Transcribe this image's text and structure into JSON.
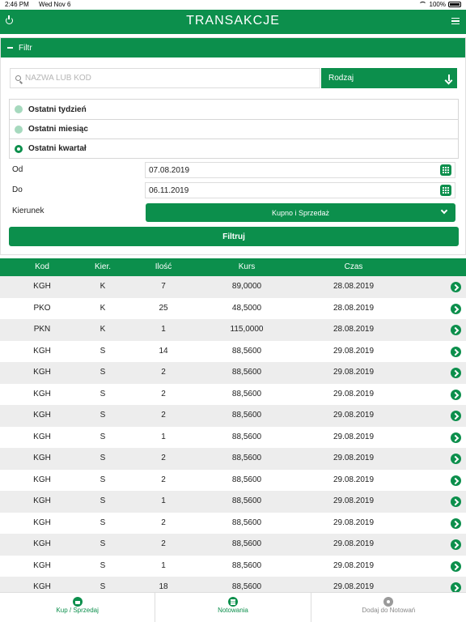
{
  "status_bar": {
    "time": "2:46 PM",
    "date": "Wed Nov 6",
    "battery": "100%"
  },
  "header": {
    "title": "TRANSAKCJE"
  },
  "filter": {
    "toggle_label": "Filtr",
    "search_placeholder": "NAZWA LUB KOD",
    "kind_label": "Rodzaj",
    "periods": [
      {
        "label": "Ostatni tydzień",
        "selected": false
      },
      {
        "label": "Ostatni miesiąc",
        "selected": false
      },
      {
        "label": "Ostatni kwartał",
        "selected": true
      }
    ],
    "from_label": "Od",
    "from_value": "07.08.2019",
    "to_label": "Do",
    "to_value": "06.11.2019",
    "direction_label": "Kierunek",
    "direction_value": "Kupno i Sprzedaż",
    "submit_label": "Filtruj"
  },
  "table": {
    "columns": {
      "kod": "Kod",
      "kier": "Kier.",
      "ilosc": "Ilość",
      "kurs": "Kurs",
      "czas": "Czas"
    },
    "rows": [
      {
        "kod": "KGH",
        "kier": "K",
        "ilosc": "7",
        "kurs": "89,0000",
        "czas": "28.08.2019"
      },
      {
        "kod": "PKO",
        "kier": "K",
        "ilosc": "25",
        "kurs": "48,5000",
        "czas": "28.08.2019"
      },
      {
        "kod": "PKN",
        "kier": "K",
        "ilosc": "1",
        "kurs": "115,0000",
        "czas": "28.08.2019"
      },
      {
        "kod": "KGH",
        "kier": "S",
        "ilosc": "14",
        "kurs": "88,5600",
        "czas": "29.08.2019"
      },
      {
        "kod": "KGH",
        "kier": "S",
        "ilosc": "2",
        "kurs": "88,5600",
        "czas": "29.08.2019"
      },
      {
        "kod": "KGH",
        "kier": "S",
        "ilosc": "2",
        "kurs": "88,5600",
        "czas": "29.08.2019"
      },
      {
        "kod": "KGH",
        "kier": "S",
        "ilosc": "2",
        "kurs": "88,5600",
        "czas": "29.08.2019"
      },
      {
        "kod": "KGH",
        "kier": "S",
        "ilosc": "1",
        "kurs": "88,5600",
        "czas": "29.08.2019"
      },
      {
        "kod": "KGH",
        "kier": "S",
        "ilosc": "2",
        "kurs": "88,5600",
        "czas": "29.08.2019"
      },
      {
        "kod": "KGH",
        "kier": "S",
        "ilosc": "2",
        "kurs": "88,5600",
        "czas": "29.08.2019"
      },
      {
        "kod": "KGH",
        "kier": "S",
        "ilosc": "1",
        "kurs": "88,5600",
        "czas": "29.08.2019"
      },
      {
        "kod": "KGH",
        "kier": "S",
        "ilosc": "2",
        "kurs": "88,5600",
        "czas": "29.08.2019"
      },
      {
        "kod": "KGH",
        "kier": "S",
        "ilosc": "2",
        "kurs": "88,5600",
        "czas": "29.08.2019"
      },
      {
        "kod": "KGH",
        "kier": "S",
        "ilosc": "1",
        "kurs": "88,5600",
        "czas": "29.08.2019"
      },
      {
        "kod": "KGH",
        "kier": "S",
        "ilosc": "18",
        "kurs": "88,5600",
        "czas": "29.08.2019"
      }
    ]
  },
  "tab_bar": {
    "tabs": [
      {
        "label": "Kup / Sprzedaj",
        "icon": "basket-icon"
      },
      {
        "label": "Notowania",
        "icon": "list-icon"
      },
      {
        "label": "Dodaj do Notowań",
        "icon": "eye-icon"
      }
    ]
  },
  "colors": {
    "accent": "#0c8f4c",
    "row_alt": "#ededed"
  }
}
